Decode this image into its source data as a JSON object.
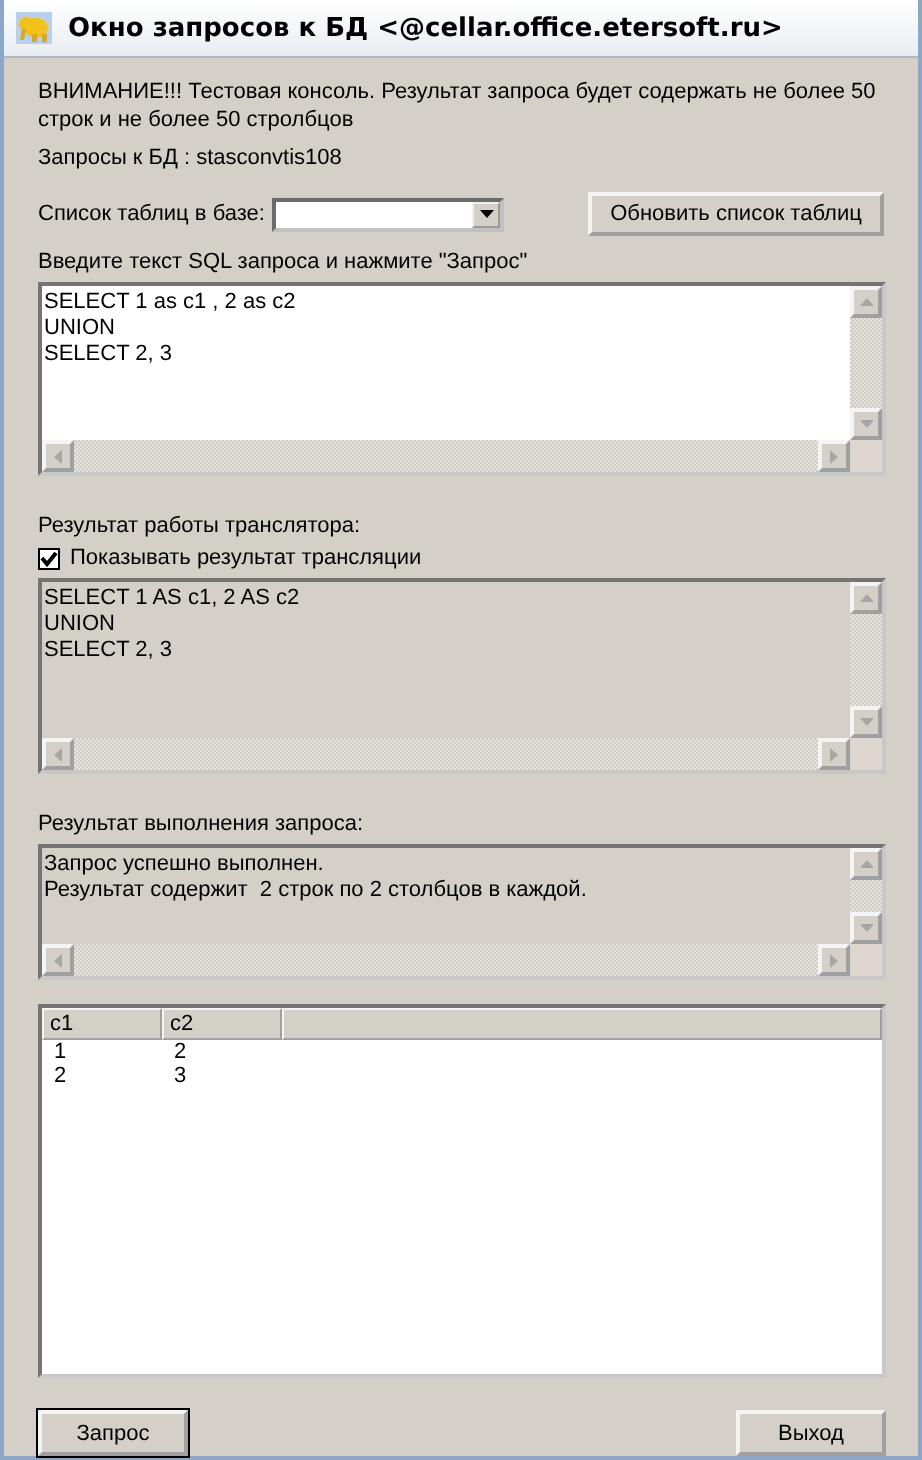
{
  "window": {
    "title": "Окно запросов к БД <@cellar.office.etersoft.ru>"
  },
  "warning": "ВНИМАНИЕ!!! Тестовая консоль. Результат запроса будет содержать не более 50 строк и не более 50 стролбцов",
  "database_label": "Запросы к БД : stasconvtis108",
  "table_list": {
    "label": "Список таблиц в базе:",
    "refresh_button": "Обновить список таблиц"
  },
  "query": {
    "label": "Введите текст SQL запроса и нажмите \"Запрос\"",
    "lines": [
      "SELECT 1 as c1 , 2 as c2",
      "UNION",
      "SELECT 2, 3"
    ]
  },
  "translator": {
    "label": "Результат работы транслятора:",
    "show_checkbox": {
      "label": "Показывать результат трансляции",
      "checked": true
    },
    "lines": [
      "SELECT 1 AS c1, 2 AS c2",
      "UNION",
      "SELECT 2, 3"
    ]
  },
  "execution": {
    "label": "Результат выполнения запроса:",
    "lines": [
      "Запрос успешно выполнен.",
      "Результат содержит  2 строк по 2 столбцов в каждой."
    ]
  },
  "results": {
    "columns": [
      "c1",
      "c2"
    ],
    "rows": [
      [
        "1",
        "2"
      ],
      [
        "2",
        "3"
      ]
    ]
  },
  "buttons": [
    "Запрос",
    "Выход"
  ]
}
